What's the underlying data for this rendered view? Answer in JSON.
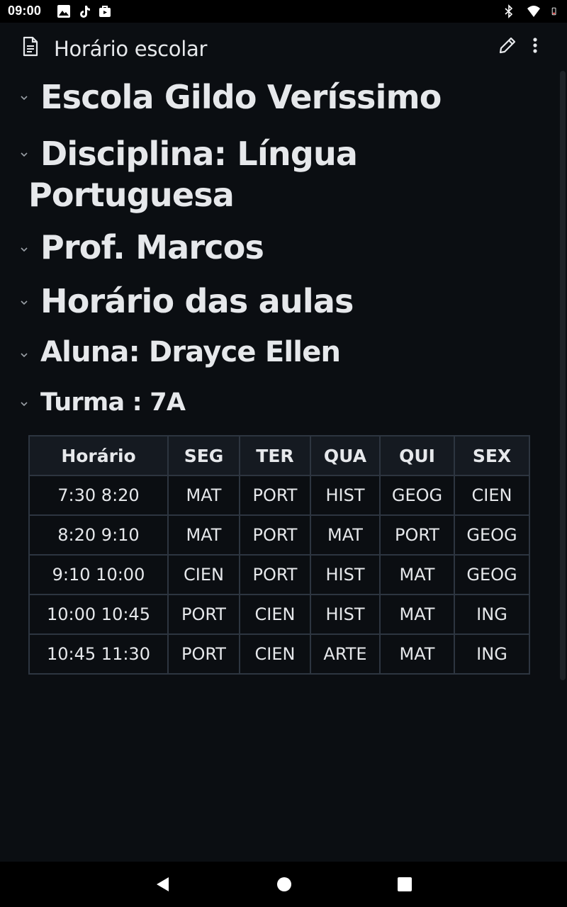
{
  "status_bar": {
    "time": "09:00",
    "left_icons": [
      "gallery-icon",
      "tiktok-icon",
      "bag-icon"
    ],
    "right_icons": [
      "bluetooth-icon",
      "wifi-icon",
      "battery-icon"
    ]
  },
  "app_bar": {
    "title": "Horário escolar",
    "icon": "document-icon",
    "actions": [
      "edit-icon",
      "more-vert-icon"
    ]
  },
  "headings": [
    {
      "text": "Escola Gildo Veríssimo"
    },
    {
      "line1": "Disciplina: Língua",
      "line2": "Portuguesa"
    },
    {
      "text": "Prof. Marcos"
    },
    {
      "text": "Horário das aulas"
    },
    {
      "text": "Aluna: Drayce Ellen"
    },
    {
      "text": "Turma : 7A"
    }
  ],
  "table": {
    "headers": [
      "Horário",
      "SEG",
      "TER",
      "QUA",
      "QUI",
      "SEX"
    ],
    "rows": [
      [
        "7:30 8:20",
        "MAT",
        "PORT",
        "HIST",
        "GEOG",
        "CIEN"
      ],
      [
        "8:20 9:10",
        "MAT",
        "PORT",
        "MAT",
        "PORT",
        "GEOG"
      ],
      [
        "9:10 10:00",
        "CIEN",
        "PORT",
        "HIST",
        "MAT",
        "GEOG"
      ],
      [
        "10:00 10:45",
        "PORT",
        "CIEN",
        "HIST",
        "MAT",
        "ING"
      ],
      [
        "10:45 11:30",
        "PORT",
        "CIEN",
        "ARTE",
        "MAT",
        "ING"
      ]
    ]
  },
  "nav_bar": {
    "buttons": [
      "back-icon",
      "home-icon",
      "recents-icon"
    ]
  }
}
